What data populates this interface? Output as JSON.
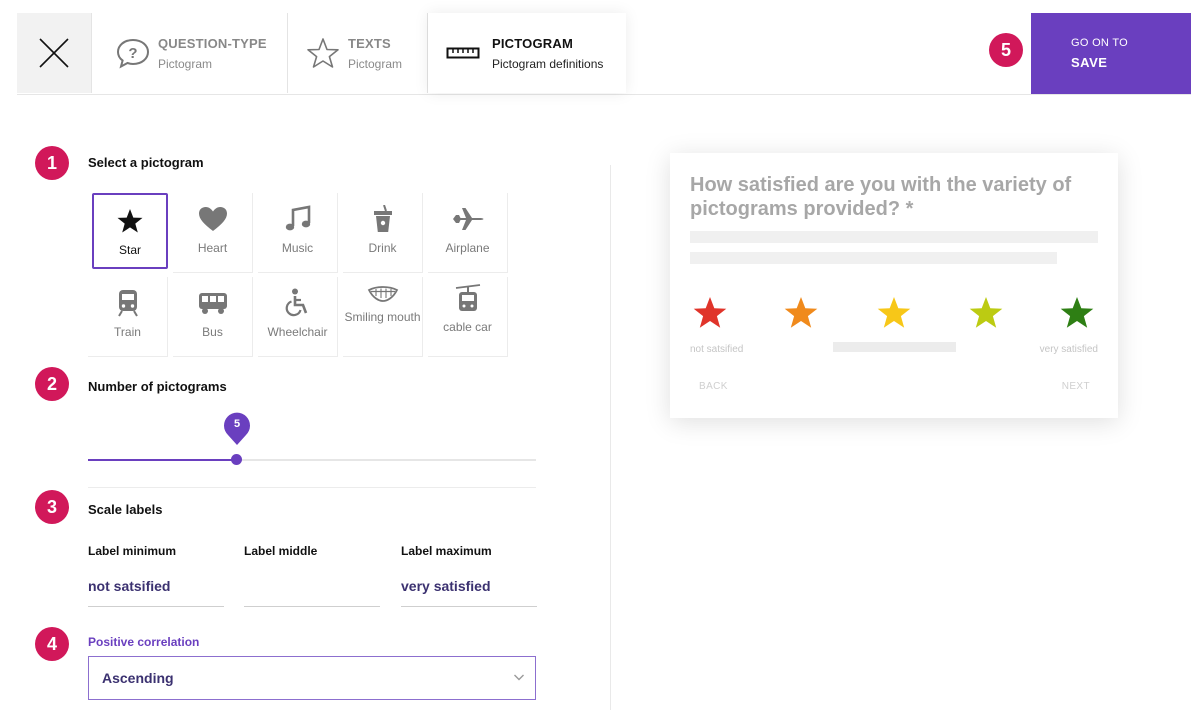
{
  "header": {
    "steps": [
      {
        "title": "QUESTION-TYPE",
        "subtitle": "Pictogram",
        "icon": "question-circle-icon"
      },
      {
        "title": "TEXTS",
        "subtitle": "Pictogram",
        "icon": "star-outline-icon"
      },
      {
        "title": "PICTOGRAM",
        "subtitle": "Pictogram definitions",
        "icon": "ruler-icon"
      }
    ],
    "save": {
      "line1": "GO ON TO",
      "line2": "SAVE"
    },
    "badge": "5"
  },
  "settings": {
    "pictogram": {
      "badge": "1",
      "title": "Select a pictogram",
      "items": [
        {
          "label": "Star",
          "icon": "star-icon"
        },
        {
          "label": "Heart",
          "icon": "heart-icon"
        },
        {
          "label": "Music",
          "icon": "music-note-icon"
        },
        {
          "label": "Drink",
          "icon": "drink-cup-icon"
        },
        {
          "label": "Airplane",
          "icon": "airplane-icon"
        },
        {
          "label": "Train",
          "icon": "train-icon"
        },
        {
          "label": "Bus",
          "icon": "bus-icon"
        },
        {
          "label": "Wheelchair",
          "icon": "wheelchair-icon"
        },
        {
          "label": "Smiling mouth",
          "icon": "smiling-mouth-icon"
        },
        {
          "label": "cable car",
          "icon": "cable-car-icon"
        }
      ],
      "selected": "Star"
    },
    "count": {
      "badge": "2",
      "title": "Number of pictograms",
      "value": "5"
    },
    "scale": {
      "badge": "3",
      "title": "Scale labels",
      "min_label": "Label minimum",
      "mid_label": "Label middle",
      "max_label": "Label maximum",
      "min_value": "not satsified",
      "mid_value": "",
      "max_value": "very satisfied"
    },
    "correlation": {
      "badge": "4",
      "label": "Positive correlation",
      "value": "Ascending"
    }
  },
  "preview": {
    "question": "How satisfied are you with the variety of pictograms provided? *",
    "star_colors": [
      "#e0342a",
      "#f08a1c",
      "#f7c718",
      "#bccb12",
      "#2e7f14"
    ],
    "label_min": "not satsified",
    "label_max": "very satisfied",
    "back": "BACK",
    "next": "NEXT"
  }
}
